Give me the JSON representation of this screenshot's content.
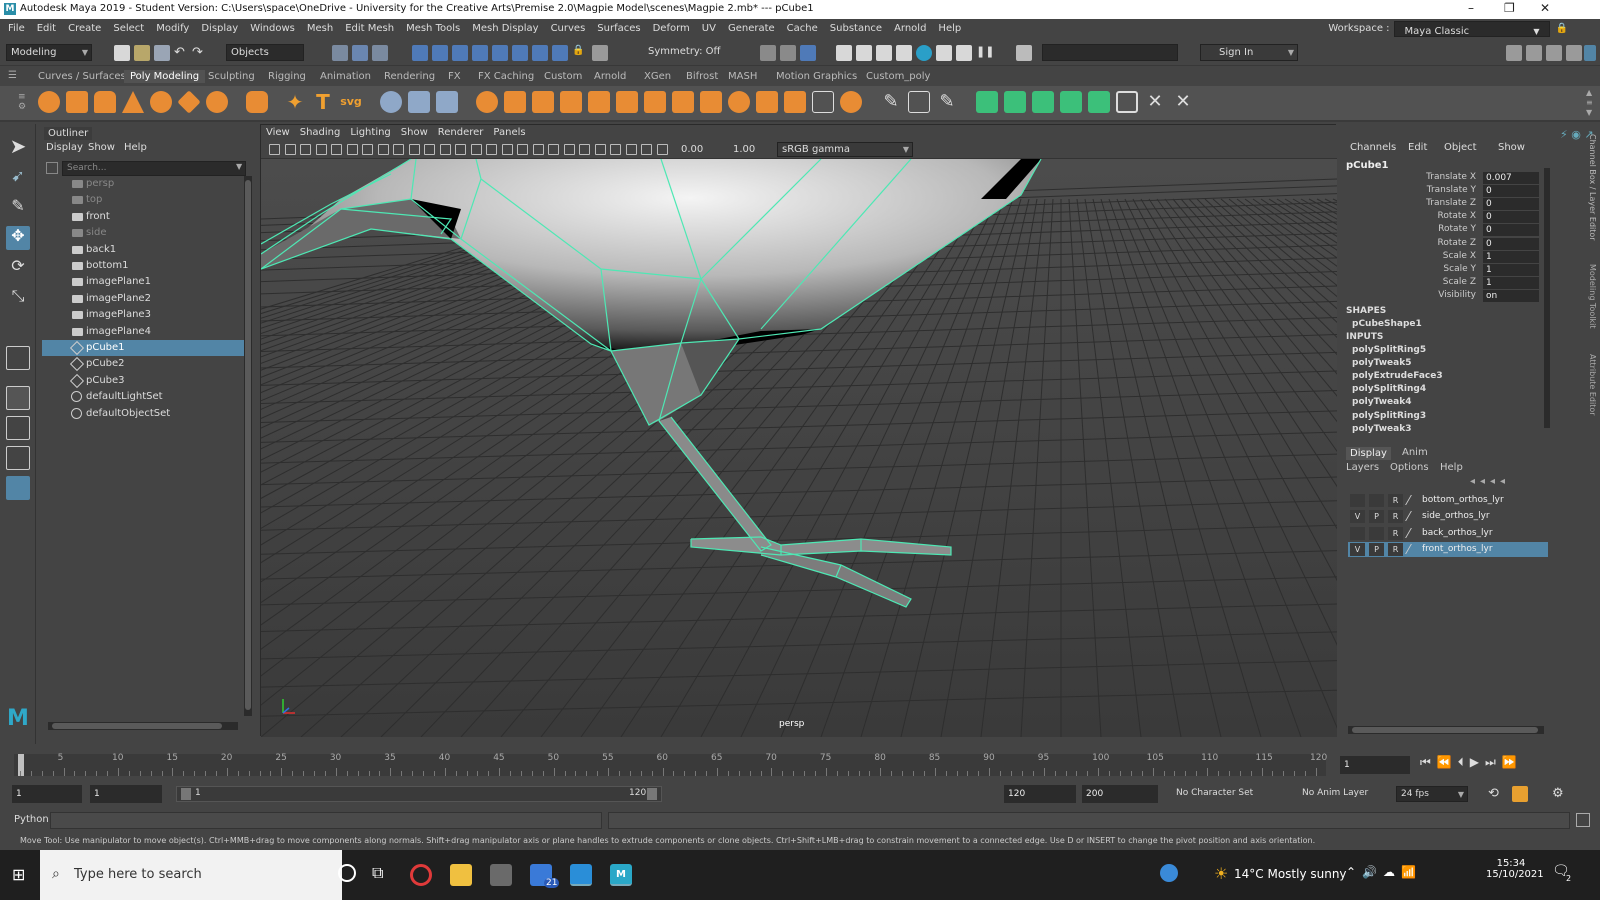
{
  "titlebar": {
    "logo": "M",
    "title": "Autodesk Maya 2019 - Student Version: C:\\Users\\space\\OneDrive - University for the Creative Arts\\Premise 2.0\\Magpie Model\\scenes\\Magpie 2.mb*   ---   pCube1",
    "minimize": "–",
    "restore": "❐",
    "close": "✕"
  },
  "menubar": {
    "items": [
      "File",
      "Edit",
      "Create",
      "Select",
      "Modify",
      "Display",
      "Windows",
      "Mesh",
      "Edit Mesh",
      "Mesh Tools",
      "Mesh Display",
      "Curves",
      "Surfaces",
      "Deform",
      "UV",
      "Generate",
      "Cache",
      "Substance",
      "Arnold",
      "Help"
    ],
    "workspace_label": "Workspace :",
    "workspace_value": "Maya Classic"
  },
  "statusline": {
    "mode": "Modeling",
    "objects": "Objects",
    "symmetry": "Symmetry: Off",
    "sign_in": "Sign In"
  },
  "shelf": {
    "tabs": [
      "Curves / Surfaces",
      "Poly Modeling",
      "Sculpting",
      "Rigging",
      "Animation",
      "Rendering",
      "FX",
      "FX Caching",
      "Custom",
      "Arnold",
      "XGen",
      "Bifrost",
      "MASH",
      "Motion Graphics",
      "Custom_poly"
    ],
    "active_tab": "Poly Modeling",
    "t_label": "T",
    "svg_label": "svg"
  },
  "outliner": {
    "title": "Outliner",
    "menu": [
      "Display",
      "Show",
      "Help"
    ],
    "search_placeholder": "Search...",
    "items": [
      {
        "label": "persp",
        "kind": "camera",
        "dim": true
      },
      {
        "label": "top",
        "kind": "camera",
        "dim": true
      },
      {
        "label": "front",
        "kind": "camera",
        "dim": false
      },
      {
        "label": "side",
        "kind": "camera",
        "dim": true
      },
      {
        "label": "back1",
        "kind": "camera",
        "dim": false
      },
      {
        "label": "bottom1",
        "kind": "camera",
        "dim": false
      },
      {
        "label": "imagePlane1",
        "kind": "image",
        "dim": false
      },
      {
        "label": "imagePlane2",
        "kind": "image",
        "dim": false
      },
      {
        "label": "imagePlane3",
        "kind": "image",
        "dim": false
      },
      {
        "label": "imagePlane4",
        "kind": "image",
        "dim": false
      },
      {
        "label": "pCube1",
        "kind": "mesh",
        "dim": false,
        "selected": true
      },
      {
        "label": "pCube2",
        "kind": "mesh",
        "dim": false
      },
      {
        "label": "pCube3",
        "kind": "mesh",
        "dim": false
      },
      {
        "label": "defaultLightSet",
        "kind": "set",
        "dim": false
      },
      {
        "label": "defaultObjectSet",
        "kind": "set",
        "dim": false
      }
    ]
  },
  "viewport": {
    "menu": [
      "View",
      "Shading",
      "Lighting",
      "Show",
      "Renderer",
      "Panels"
    ],
    "exposure": "0.00",
    "gamma": "1.00",
    "colorspace": "sRGB gamma",
    "camera_label": "persp"
  },
  "channelbox": {
    "menu": [
      "Channels",
      "Edit",
      "Object",
      "Show"
    ],
    "object": "pCube1",
    "channels": [
      {
        "label": "Translate X",
        "value": "0.007"
      },
      {
        "label": "Translate Y",
        "value": "0"
      },
      {
        "label": "Translate Z",
        "value": "0"
      },
      {
        "label": "Rotate X",
        "value": "0"
      },
      {
        "label": "Rotate Y",
        "value": "0"
      },
      {
        "label": "Rotate Z",
        "value": "0"
      },
      {
        "label": "Scale X",
        "value": "1"
      },
      {
        "label": "Scale Y",
        "value": "1"
      },
      {
        "label": "Scale Z",
        "value": "1"
      },
      {
        "label": "Visibility",
        "value": "on"
      }
    ],
    "shapes_header": "SHAPES",
    "shape": "pCubeShape1",
    "inputs_header": "INPUTS",
    "inputs": [
      "polySplitRing5",
      "polyTweak5",
      "polyExtrudeFace3",
      "polySplitRing4",
      "polyTweak4",
      "polySplitRing3",
      "polyTweak3"
    ]
  },
  "layers": {
    "tabs": [
      "Display",
      "Anim"
    ],
    "menu": [
      "Layers",
      "Options",
      "Help"
    ],
    "rows": [
      {
        "v": "",
        "p": "",
        "r": "R",
        "name": "bottom_orthos_lyr",
        "selected": false
      },
      {
        "v": "V",
        "p": "P",
        "r": "R",
        "name": "side_orthos_lyr",
        "selected": false
      },
      {
        "v": "",
        "p": "",
        "r": "R",
        "name": "back_orthos_lyr",
        "selected": false
      },
      {
        "v": "V",
        "p": "P",
        "r": "R",
        "name": "front_orthos_lyr",
        "selected": true
      }
    ]
  },
  "side_tabs": [
    "Channel Box / Layer Editor",
    "Modeling Toolkit",
    "Attribute Editor"
  ],
  "timeline": {
    "ticks": [
      "5",
      "10",
      "15",
      "20",
      "25",
      "30",
      "35",
      "40",
      "45",
      "50",
      "55",
      "60",
      "65",
      "70",
      "75",
      "80",
      "85",
      "90",
      "95",
      "100",
      "105",
      "110",
      "115",
      "120"
    ],
    "first": "1",
    "current_frame": "1"
  },
  "range": {
    "start": "1",
    "playback_start": "1",
    "slider_start": "1",
    "slider_end": "120",
    "playback_end": "120",
    "end": "200",
    "character_set": "No Character Set",
    "anim_layer": "No Anim Layer",
    "fps": "24 fps"
  },
  "commandline": {
    "label": "Python"
  },
  "helpline": "Move Tool: Use manipulator to move object(s). Ctrl+MMB+drag to move components along normals. Shift+drag manipulator axis or plane handles to extrude components or clone objects. Ctrl+Shift+LMB+drag to constrain movement to a connected edge. Use D or INSERT to change the pivot position and axis orientation.",
  "taskbar": {
    "search_placeholder": "Type here to search",
    "mail_badge": "21",
    "weather": "14°C  Mostly sunny",
    "time": "15:34",
    "date": "15/10/2021",
    "notif": "2"
  },
  "colors": {
    "accent": "#5285a6",
    "wire": "#4ee8b4",
    "bg": "#444444"
  }
}
